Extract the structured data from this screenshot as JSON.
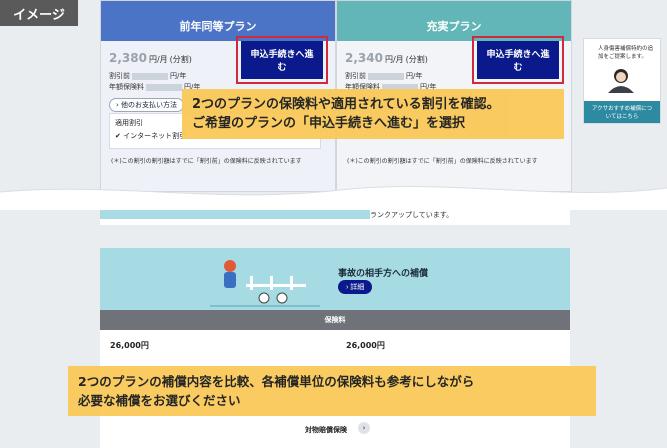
{
  "badge": "イメージ",
  "plans": [
    {
      "name": "前年同等プラン",
      "price": "2,380",
      "price_unit": "円/月",
      "price_note": "(分割)",
      "discount_label": "割引前",
      "discount_suffix": "円/年",
      "annual_label": "年額保険料",
      "annual_suffix": "円/年",
      "apply_label": "申込手続きへ進む"
    },
    {
      "name": "充実プラン",
      "price": "2,340",
      "price_unit": "円/月",
      "price_note": "(分割)",
      "discount_label": "割引前",
      "discount_suffix": "円/年",
      "annual_label": "年額保険料",
      "annual_suffix": "円/年",
      "apply_label": "申込手続きへ進む"
    }
  ],
  "payment_link": "他のお支払い方法",
  "discount_box": {
    "title": "適用割引",
    "item": "インターネット割引"
  },
  "discount_note": "(＊)この割引の割引額はすでに「割引前」の保険料に反映されています",
  "callout_top": [
    "2つのプランの保険料や適用されている割引を確認。",
    "ご希望のプランの「申込手続きへ進む」を選択"
  ],
  "strip_text": "ランクアップしています。",
  "hero": {
    "title": "事故の相手方への補償",
    "button": "詳細"
  },
  "section_label": "保険料",
  "amounts": [
    "26,000円",
    "26,000円"
  ],
  "callout_bottom": [
    "2つのプランの補償内容を比較、各補償単位の保険料も参考にしながら",
    "必要な補償をお選びください"
  ],
  "footer_label": "対物賠償保険",
  "side": {
    "message": "人身傷害補償特約の追加をご提案します。",
    "cta": "アクサおすすめ補償についてはこちら"
  }
}
